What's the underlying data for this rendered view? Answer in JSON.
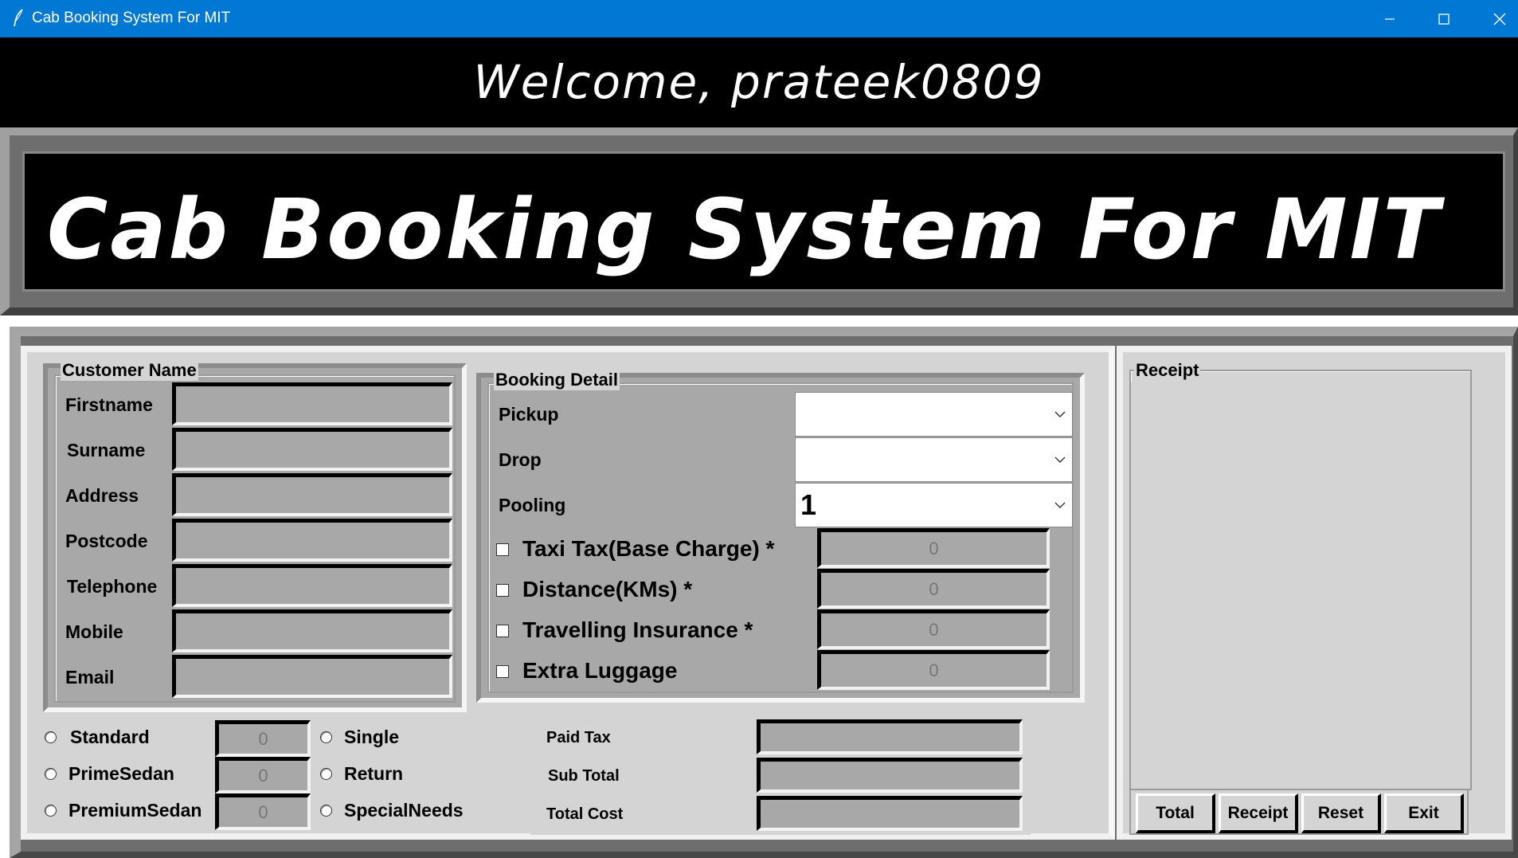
{
  "window": {
    "title": "Cab Booking System For MIT",
    "controls": {
      "minimize": "minimize-icon",
      "maximize": "maximize-icon",
      "close": "close-icon"
    }
  },
  "welcome": "Welcome,  prateek0809",
  "banner_title": "Cab  Booking  System  For  MIT",
  "customer": {
    "legend": "Customer Name",
    "fields": [
      {
        "label": "Firstname",
        "value": ""
      },
      {
        "label": "Surname",
        "value": ""
      },
      {
        "label": "Address",
        "value": ""
      },
      {
        "label": "Postcode",
        "value": ""
      },
      {
        "label": "Telephone",
        "value": ""
      },
      {
        "label": "Mobile",
        "value": ""
      },
      {
        "label": "Email",
        "value": ""
      }
    ]
  },
  "booking": {
    "legend": "Booking Detail",
    "pickup_label": "Pickup",
    "pickup_value": "",
    "drop_label": "Drop",
    "drop_value": "",
    "pooling_label": "Pooling",
    "pooling_value": "1",
    "charges": [
      {
        "label": "Taxi Tax(Base Charge) *",
        "value": "0",
        "checked": false
      },
      {
        "label": "Distance(KMs) *",
        "value": "0",
        "checked": false
      },
      {
        "label": "Travelling Insurance *",
        "value": "0",
        "checked": false
      },
      {
        "label": "Extra Luggage",
        "value": "0",
        "checked": false
      }
    ]
  },
  "car_types": [
    {
      "label": "Standard",
      "value": "0"
    },
    {
      "label": "PrimeSedan",
      "value": "0"
    },
    {
      "label": "PremiumSedan",
      "value": "0"
    }
  ],
  "journey_types": [
    {
      "label": "Single"
    },
    {
      "label": "Return"
    },
    {
      "label": "SpecialNeeds"
    }
  ],
  "totals": [
    {
      "label": "Paid Tax",
      "value": ""
    },
    {
      "label": "Sub Total",
      "value": ""
    },
    {
      "label": "Total Cost",
      "value": ""
    }
  ],
  "receipt": {
    "legend": "Receipt",
    "content": "",
    "buttons": [
      "Total",
      "Receipt",
      "Reset",
      "Exit"
    ]
  }
}
